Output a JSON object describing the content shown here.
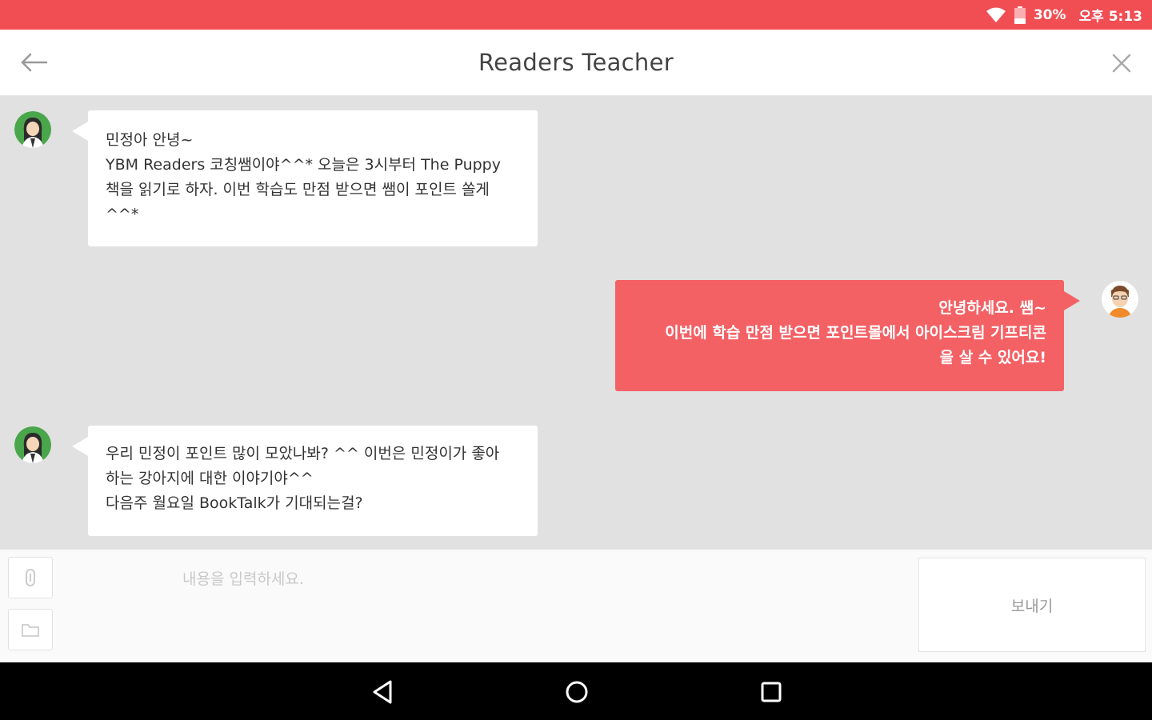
{
  "status_bar": {
    "battery": "30%",
    "time": "오후 5:13",
    "bg_color": "#f14e54"
  },
  "header": {
    "title": "Readers Teacher",
    "back_icon": "back-arrow-icon",
    "close_icon": "close-icon"
  },
  "messages": [
    {
      "sender": "teacher",
      "avatar": "teacher-avatar",
      "lines": [
        "민정아 안녕~",
        "YBM Readers 코칭쌤이야^^* 오늘은 3시부터 The Puppy",
        "책을 읽기로 하자. 이번 학습도 만점 받으면 쌤이 포인트 쏠게",
        "^^*"
      ]
    },
    {
      "sender": "student",
      "avatar": "student-avatar",
      "lines": [
        "안녕하세요. 쌤~",
        "이번에 학습 만점 받으면 포인트몰에서 아이스크림 기프티콘",
        "을 살 수 있어요!"
      ]
    },
    {
      "sender": "teacher",
      "avatar": "teacher-avatar",
      "lines": [
        "우리 민정이 포인트 많이 모았나봐? ^^ 이번은 민정이가 좋아",
        "하는 강아지에 대한 이야기야^^",
        "다음주 월요일 BookTalk가 기대되는걸?"
      ]
    }
  ],
  "composer": {
    "placeholder": "내용을 입력하세요.",
    "value": "",
    "send_label": "보내기",
    "attach_icon": "paperclip-icon",
    "folder_icon": "folder-icon"
  },
  "colors": {
    "accent": "#f36165",
    "chat_bg": "#e1e1e1"
  }
}
